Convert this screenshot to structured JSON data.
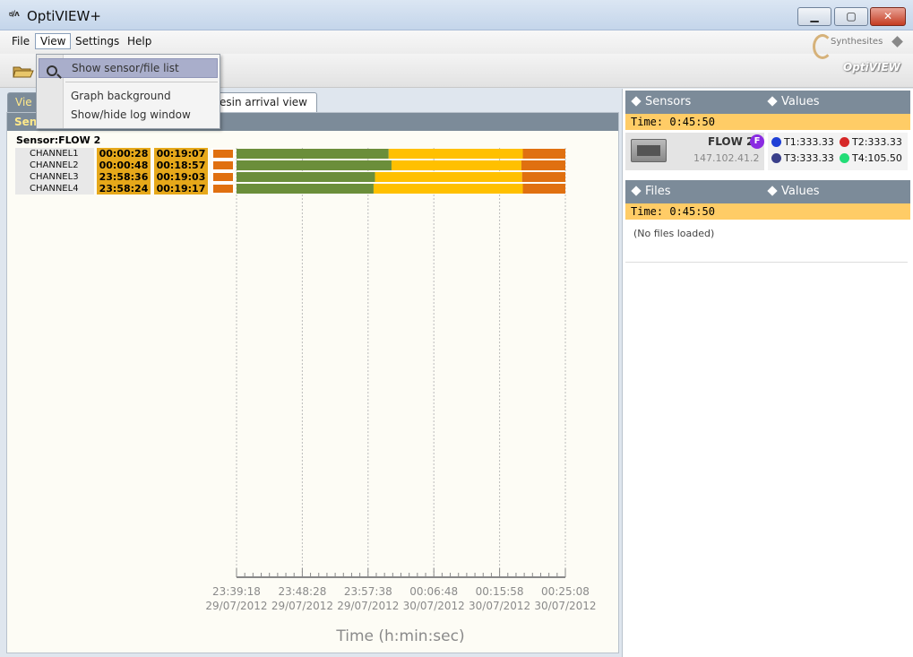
{
  "window": {
    "icon_text": "ಠ/ʌ",
    "title": "OptiVIEW+",
    "min_label": "▁",
    "max_label": "▢",
    "close_label": "✕"
  },
  "menu": {
    "file": "File",
    "view": "View",
    "settings": "Settings",
    "help": "Help"
  },
  "brand": {
    "company": "Synthesites",
    "product": "OptiVIEW"
  },
  "view_menu": {
    "items": [
      "Show sensor/file list",
      "Graph background",
      "Show/hide log window"
    ]
  },
  "tabs": {
    "first": "Vie",
    "second": "esin arrival view"
  },
  "left_panel": {
    "header": "Sens",
    "sensor_label": "Sensor:FLOW 2",
    "channels": [
      {
        "name": "CHANNEL1",
        "time1": "00:00:28",
        "time2": "00:19:07"
      },
      {
        "name": "CHANNEL2",
        "time1": "00:00:48",
        "time2": "00:18:57"
      },
      {
        "name": "CHANNEL3",
        "time1": "23:58:36",
        "time2": "00:19:03"
      },
      {
        "name": "CHANNEL4",
        "time1": "23:58:24",
        "time2": "00:19:17"
      }
    ]
  },
  "chart_data": {
    "type": "bar",
    "xlabel": "Time (h:min:sec)",
    "x_ticks": [
      {
        "time": "23:39:18",
        "date": "29/07/2012"
      },
      {
        "time": "23:48:28",
        "date": "29/07/2012"
      },
      {
        "time": "23:57:38",
        "date": "29/07/2012"
      },
      {
        "time": "00:06:48",
        "date": "30/07/2012"
      },
      {
        "time": "00:15:58",
        "date": "30/07/2012"
      },
      {
        "time": "00:25:08",
        "date": "30/07/2012"
      }
    ],
    "axis_range_minutes": [
      0,
      45.83
    ],
    "series_colors": {
      "green": "#6b8e3a",
      "yellow": "#ffc000",
      "orange": "#e07010"
    },
    "rows": [
      {
        "category": "CHANNEL1",
        "segments_minutes": [
          {
            "color": "green",
            "from": 0,
            "to": 21.2
          },
          {
            "color": "yellow",
            "from": 21.2,
            "to": 39.9
          },
          {
            "color": "orange",
            "from": 39.9,
            "to": 45.83
          }
        ]
      },
      {
        "category": "CHANNEL2",
        "segments_minutes": [
          {
            "color": "green",
            "from": 0,
            "to": 21.6
          },
          {
            "color": "yellow",
            "from": 21.6,
            "to": 39.7
          },
          {
            "color": "orange",
            "from": 39.7,
            "to": 45.83
          }
        ]
      },
      {
        "category": "CHANNEL3",
        "segments_minutes": [
          {
            "color": "green",
            "from": 0,
            "to": 19.3
          },
          {
            "color": "yellow",
            "from": 19.3,
            "to": 39.8
          },
          {
            "color": "orange",
            "from": 39.8,
            "to": 45.83
          }
        ]
      },
      {
        "category": "CHANNEL4",
        "segments_minutes": [
          {
            "color": "green",
            "from": 0,
            "to": 19.1
          },
          {
            "color": "yellow",
            "from": 19.1,
            "to": 39.9
          },
          {
            "color": "orange",
            "from": 39.9,
            "to": 45.83
          }
        ]
      }
    ],
    "grid": true
  },
  "sensors_panel": {
    "header_left": "Sensors",
    "header_right": "Values",
    "time": "Time: 0:45:50",
    "sensor_name": "FLOW 2",
    "badge": "F",
    "ip": "147.102.41.2",
    "values": [
      {
        "label": "T1:333.33",
        "color": "#1f3fd6"
      },
      {
        "label": "T2:333.33",
        "color": "#d62828"
      },
      {
        "label": "T3:333.33",
        "color": "#3a3f8a"
      },
      {
        "label": "T4:105.50",
        "color": "#22dd77"
      }
    ]
  },
  "files_panel": {
    "header_left": "Files",
    "header_right": "Values",
    "time": "Time: 0:45:50",
    "empty_text": "(No files loaded)"
  }
}
